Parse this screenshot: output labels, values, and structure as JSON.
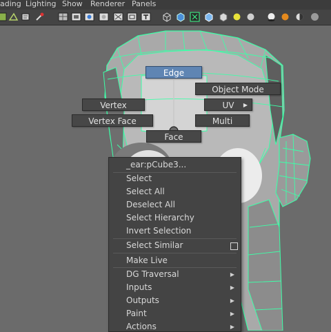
{
  "menubar": [
    "ading",
    "Lighting",
    "Show",
    "Renderer",
    "Panels"
  ],
  "toolbar_icons": [
    "grid-icon",
    "select-vertex-icon",
    "lasso-icon",
    "paint-icon",
    "wireframe-icon",
    "film-gate-icon",
    "camera-icon",
    "sphere-icon",
    "xray-icon",
    "frame-icon",
    "text-icon",
    "cube-wire-icon",
    "cube-shaded-icon",
    "isolate-icon",
    "cube-textured-icon",
    "light-icon",
    "sphere-lit-icon",
    "shadow-icon",
    "orange-sphere-icon",
    "contrast-icon",
    "gray-sphere-icon"
  ],
  "marking_menu": {
    "edge": "Edge",
    "object_mode": "Object Mode",
    "vertex": "Vertex",
    "uv": "UV",
    "vertex_face": "Vertex Face",
    "multi": "Multi",
    "face": "Face"
  },
  "context_menu": {
    "header": "_ear:pCube3...",
    "select": "Select",
    "select_all": "Select All",
    "deselect_all": "Deselect All",
    "select_hierarchy": "Select Hierarchy",
    "invert_selection": "Invert Selection",
    "select_similar": "Select Similar",
    "make_live": "Make Live",
    "dg_traversal": "DG Traversal",
    "inputs": "Inputs",
    "outputs": "Outputs",
    "paint": "Paint",
    "actions": "Actions"
  },
  "colors": {
    "wire": "#3dffa8",
    "highlight": "#5f85b3",
    "menu_bg": "#444444"
  }
}
